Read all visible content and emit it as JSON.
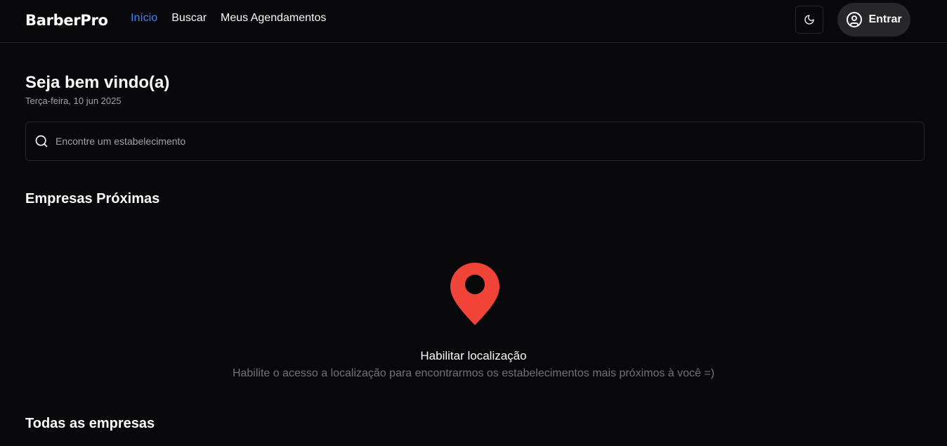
{
  "header": {
    "brand": "BarberPro",
    "nav": [
      {
        "label": "Início",
        "active": true
      },
      {
        "label": "Buscar",
        "active": false
      },
      {
        "label": "Meus Agendamentos",
        "active": false
      }
    ],
    "theme_icon": "moon-icon",
    "login": {
      "label": "Entrar",
      "icon": "user-circle-icon"
    }
  },
  "main": {
    "welcome": "Seja bem vindo(a)",
    "date": "Terça-feira, 10 jun 2025",
    "search": {
      "placeholder": "Encontre um estabelecimento",
      "value": "",
      "icon": "search-icon"
    },
    "nearby": {
      "title": "Empresas Próximas",
      "location_icon": "map-pin-icon",
      "enable_title": "Habilitar localização",
      "enable_subtitle": "Habilite o acesso a localização para encontrarmos os estabelecimentos mais próximos à você =)"
    },
    "all_companies_title": "Todas as empresas"
  },
  "colors": {
    "background": "#09090b",
    "border": "#27272a",
    "accent": "#3b82f6",
    "pin": "#f04438",
    "muted_text": "#71717a"
  }
}
